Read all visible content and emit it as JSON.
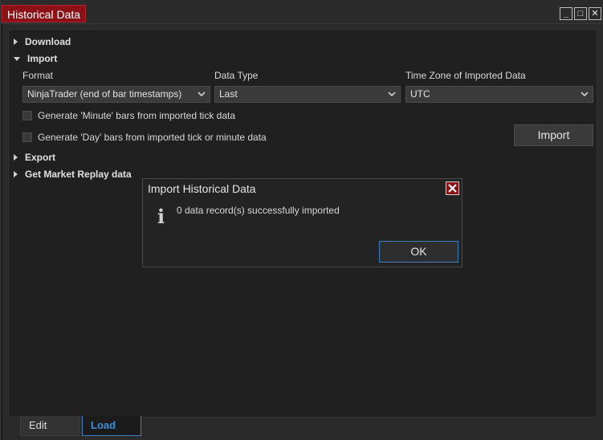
{
  "window": {
    "title": "Historical Data",
    "controls": {
      "minimize": "_",
      "maximize": "□",
      "close": "✕"
    }
  },
  "sections": {
    "download": "Download",
    "import": "Import",
    "export": "Export",
    "market_replay": "Get Market Replay data"
  },
  "import": {
    "format_label": "Format",
    "format_value": "NinjaTrader (end of bar timestamps)",
    "datatype_label": "Data Type",
    "datatype_value": "Last",
    "timezone_label": "Time Zone of Imported Data",
    "timezone_value": "UTC",
    "minute_bars_label": "Generate 'Minute' bars from imported tick data",
    "minute_bars_checked": false,
    "day_bars_label": "Generate 'Day' bars from imported tick or minute data",
    "day_bars_checked": false,
    "import_button": "Import"
  },
  "tabs": [
    {
      "label": "Edit",
      "active": false
    },
    {
      "label": "Load",
      "active": true
    }
  ],
  "dialog": {
    "title": "Import Historical Data",
    "message": "0 data record(s) successfully imported",
    "ok_button": "OK",
    "icon": "info-icon"
  },
  "colors": {
    "title_accent": "#8b1117",
    "active_tab": "#3d8fd6",
    "background": "#202020"
  }
}
